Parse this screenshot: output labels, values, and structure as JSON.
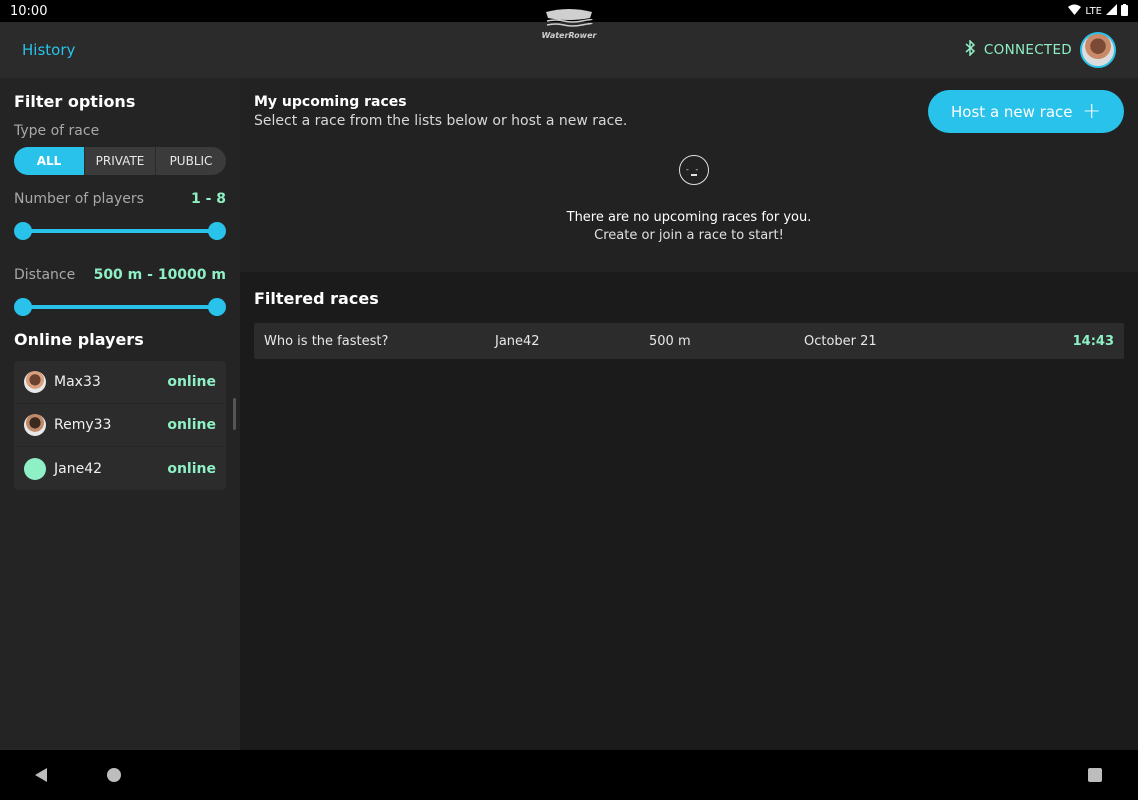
{
  "status_bar": {
    "time": "10:00",
    "network": "LTE"
  },
  "app_bar": {
    "history_label": "History",
    "logo_text": "WaterRower",
    "connection_status": "CONNECTED"
  },
  "sidebar": {
    "title": "Filter options",
    "type_label": "Type of race",
    "type_options": [
      "ALL",
      "PRIVATE",
      "PUBLIC"
    ],
    "type_selected": "ALL",
    "players_label": "Number of players",
    "players_range": "1 - 8",
    "players_min": 1,
    "players_max": 8,
    "distance_label": "Distance",
    "distance_range": "500 m - 10000 m",
    "online_title": "Online players",
    "online_players": [
      {
        "name": "Max33",
        "status": "online"
      },
      {
        "name": "Remy33",
        "status": "online"
      },
      {
        "name": "Jane42",
        "status": "online"
      }
    ]
  },
  "upcoming": {
    "title": "My upcoming races",
    "subtitle": "Select a race from the lists below or host a new race.",
    "host_button": "Host a new race",
    "empty_message": "There are no upcoming races for you.",
    "empty_sub": "Create or join a race to start!"
  },
  "filtered": {
    "title": "Filtered races",
    "races": [
      {
        "name": "Who is the fastest?",
        "host": "Jane42",
        "distance": "500 m",
        "date": "October 21",
        "time": "14:43"
      }
    ]
  },
  "colors": {
    "accent": "#29c2ea",
    "online": "#8ef0c4"
  }
}
